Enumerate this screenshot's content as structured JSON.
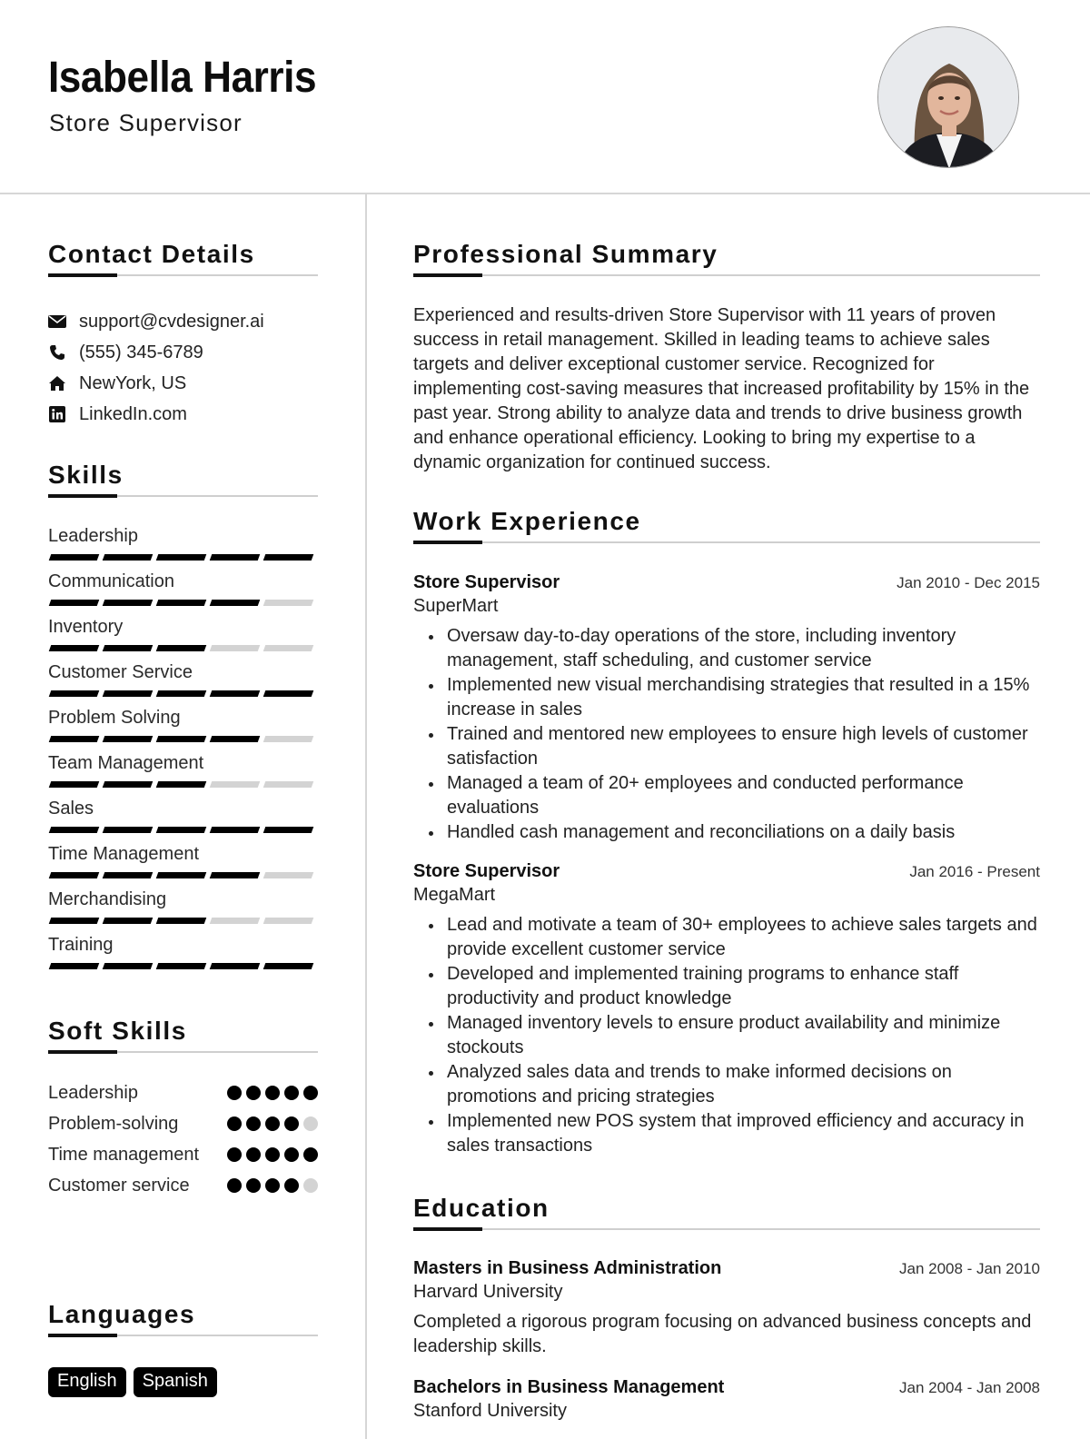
{
  "header": {
    "name": "Isabella Harris",
    "title": "Store Supervisor",
    "photo_alt": "Portrait photo of Isabella Harris"
  },
  "contact": {
    "heading": "Contact Details",
    "items": [
      {
        "icon": "envelope-icon",
        "text": "support@cvdesigner.ai"
      },
      {
        "icon": "phone-icon",
        "text": "(555) 345-6789"
      },
      {
        "icon": "home-icon",
        "text": "NewYork, US"
      },
      {
        "icon": "linkedin-icon",
        "text": "LinkedIn.com"
      }
    ]
  },
  "skills": {
    "heading": "Skills",
    "max_level": 5,
    "items": [
      {
        "name": "Leadership",
        "level": 5
      },
      {
        "name": "Communication",
        "level": 4
      },
      {
        "name": "Inventory",
        "level": 3
      },
      {
        "name": "Customer Service",
        "level": 5
      },
      {
        "name": "Problem Solving",
        "level": 4
      },
      {
        "name": "Team Management",
        "level": 3
      },
      {
        "name": "Sales",
        "level": 5
      },
      {
        "name": "Time Management",
        "level": 4
      },
      {
        "name": "Merchandising",
        "level": 3
      },
      {
        "name": "Training",
        "level": 5
      }
    ]
  },
  "soft_skills": {
    "heading": "Soft Skills",
    "max_level": 5,
    "items": [
      {
        "name": "Leadership",
        "level": 5
      },
      {
        "name": "Problem-solving",
        "level": 4
      },
      {
        "name": "Time management",
        "level": 5
      },
      {
        "name": "Customer service",
        "level": 4
      }
    ]
  },
  "languages": {
    "heading": "Languages",
    "items": [
      "English",
      "Spanish"
    ]
  },
  "summary": {
    "heading": "Professional Summary",
    "text": "Experienced and results-driven Store Supervisor with 11 years of proven success in retail management. Skilled in leading teams to achieve sales targets and deliver exceptional customer service. Recognized for implementing cost-saving measures that increased profitability by 15% in the past year. Strong ability to analyze data and trends to drive business growth and enhance operational efficiency. Looking to bring my expertise to a dynamic organization for continued success."
  },
  "experience": {
    "heading": "Work Experience",
    "jobs": [
      {
        "title": "Store Supervisor",
        "dates": "Jan 2010 - Dec 2015",
        "company": "SuperMart",
        "bullets": [
          "Oversaw day-to-day operations of the store, including inventory management, staff scheduling, and customer service",
          "Implemented new visual merchandising strategies that resulted in a 15% increase in sales",
          "Trained and mentored new employees to ensure high levels of customer satisfaction",
          "Managed a team of 20+ employees and conducted performance evaluations",
          "Handled cash management and reconciliations on a daily basis"
        ]
      },
      {
        "title": "Store Supervisor",
        "dates": "Jan 2016 - Present",
        "company": "MegaMart",
        "bullets": [
          "Lead and motivate a team of 30+ employees to achieve sales targets and provide excellent customer service",
          "Developed and implemented training programs to enhance staff productivity and product knowledge",
          "Managed inventory levels to ensure product availability and minimize stockouts",
          "Analyzed sales data and trends to make informed decisions on promotions and pricing strategies",
          "Implemented new POS system that improved efficiency and accuracy in sales transactions"
        ]
      }
    ]
  },
  "education": {
    "heading": "Education",
    "items": [
      {
        "degree": "Masters in Business Administration",
        "dates": "Jan 2008 - Jan 2010",
        "school": "Harvard University",
        "description": "Completed a rigorous program focusing on advanced business concepts and leadership skills."
      },
      {
        "degree": "Bachelors in Business Management",
        "dates": "Jan 2004 - Jan 2008",
        "school": "Stanford University"
      }
    ]
  }
}
